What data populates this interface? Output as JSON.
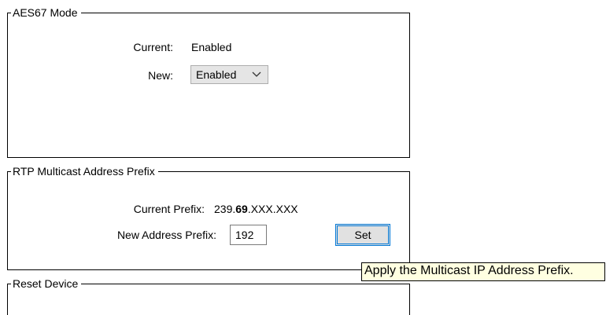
{
  "aes67": {
    "title": "AES67 Mode",
    "current_label": "Current:",
    "current_value": "Enabled",
    "new_label": "New:",
    "new_selected": "Enabled"
  },
  "rtp": {
    "title": "RTP Multicast Address Prefix",
    "current_prefix_label": "Current Prefix:",
    "prefix_part1": "239.",
    "prefix_part2": "69",
    "prefix_part3": ".XXX.XXX",
    "new_prefix_label": "New Address Prefix:",
    "new_prefix_value": "192",
    "set_label": "Set"
  },
  "reset": {
    "title": "Reset Device"
  },
  "tooltip": {
    "text": "Apply the Multicast IP Address Prefix."
  },
  "icons": {
    "dropdown": "chevron-down-icon"
  }
}
